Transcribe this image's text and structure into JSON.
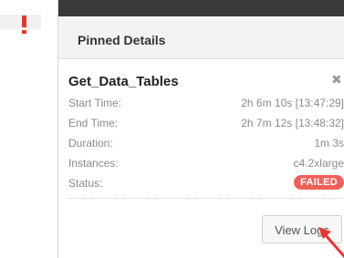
{
  "panel": {
    "title": "Pinned Details"
  },
  "job": {
    "name": "Get_Data_Tables",
    "details": [
      {
        "label": "Start Time:",
        "value": "2h 6m 10s [13:47:29]"
      },
      {
        "label": "End Time:",
        "value": "2h 7m 12s [13:48:32]"
      },
      {
        "label": "Duration:",
        "value": "1m 3s"
      },
      {
        "label": "Instances:",
        "value": "c4.2xlarge"
      }
    ],
    "status_label": "Status:",
    "status_value": "FAILED"
  },
  "actions": {
    "view_logs_label": "View Logs",
    "close_icon": "close-icon",
    "close_glyph": "✖"
  },
  "colors": {
    "alert": "#e8362f",
    "failed_badge": "#f0605a",
    "top_bar": "#3a3a3a",
    "annotation_arrow": "#e8362f"
  }
}
